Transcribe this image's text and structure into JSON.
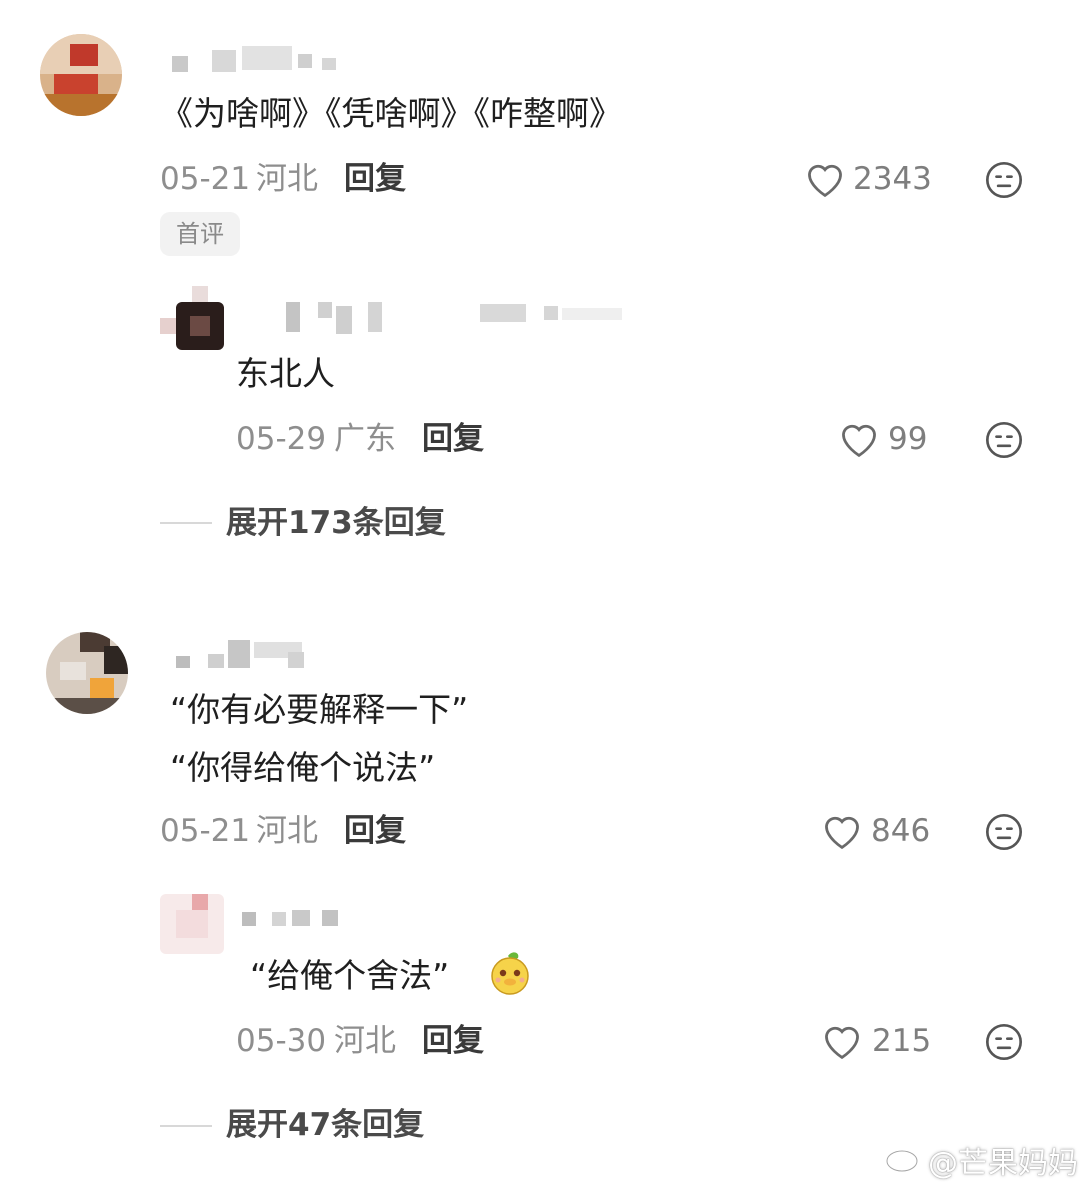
{
  "comments": [
    {
      "text": "《为啥啊》《凭啥啊》《咋整啊》",
      "date": "05-21",
      "location": "河北",
      "reply_label": "回复",
      "likes": "2343",
      "badge": "首评",
      "replies": [
        {
          "text": "东北人",
          "date": "05-29",
          "location": "广东",
          "reply_label": "回复",
          "likes": "99"
        }
      ],
      "expand_label": "展开173条回复"
    },
    {
      "lines": [
        "“你有必要解释一下”",
        "“你得给俺个说法”"
      ],
      "date": "05-21",
      "location": "河北",
      "reply_label": "回复",
      "likes": "846",
      "replies": [
        {
          "text": "“给俺个舍法”",
          "date": "05-30",
          "location": "河北",
          "reply_label": "回复",
          "likes": "215"
        }
      ],
      "expand_label": "展开47条回复"
    }
  ],
  "icons": {
    "like": "heart-outline-icon",
    "more": "neutral-face-icon",
    "sticker": "mango-sticker-icon"
  },
  "watermark": {
    "logo": "weibo-logo-icon",
    "text": "@芒果妈妈"
  },
  "colors": {
    "text": "#1f1f1f",
    "meta": "#8e8e8e",
    "line": "#d8d8d8"
  }
}
